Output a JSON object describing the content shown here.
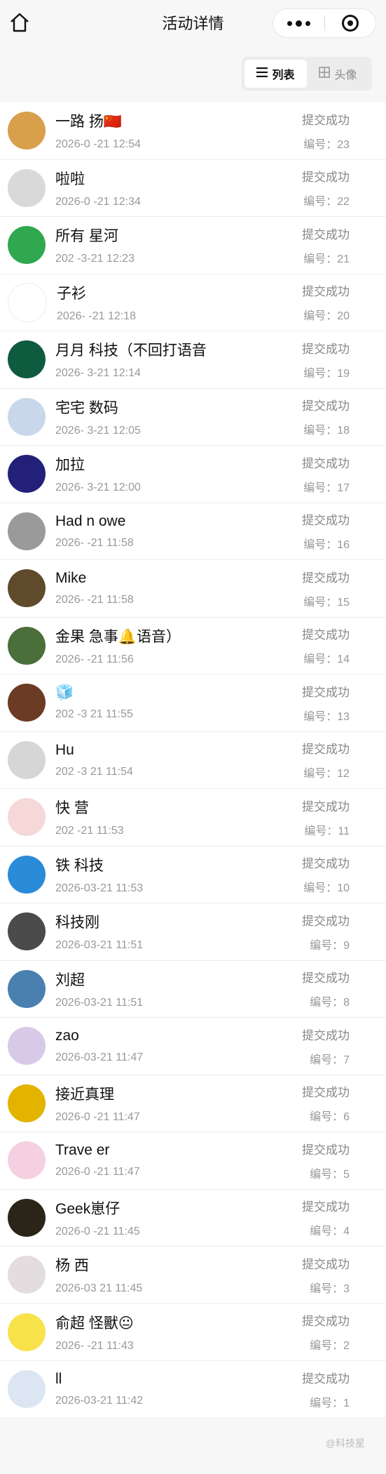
{
  "header": {
    "title": "活动详情"
  },
  "toggle": {
    "list_label": "列表",
    "avatar_label": "头像"
  },
  "status_text": "提交成功",
  "number_prefix": "编号：",
  "rows": [
    {
      "name": "一路 扬🇨🇳",
      "time": "2026-0 -21 12:54",
      "no": "23",
      "color": "#d8a04b"
    },
    {
      "name": "啦啦",
      "time": "2026-0 -21 12:34",
      "no": "22",
      "color": "#d9d9d9"
    },
    {
      "name": "所有 星河",
      "time": "202 -3-21 12:23",
      "no": "21",
      "color": "#2fa84f"
    },
    {
      "name": "子衫",
      "time": "2026- -21 12:18",
      "no": "20",
      "color": "#ffffff"
    },
    {
      "name": "月月 科技（不回打语音",
      "time": "2026- 3-21 12:14",
      "no": "19",
      "color": "#0f5b3f"
    },
    {
      "name": "宅宅 数码",
      "time": "2026- 3-21 12:05",
      "no": "18",
      "color": "#c8d7ea"
    },
    {
      "name": "加拉 ",
      "time": "2026- 3-21 12:00",
      "no": "17",
      "color": "#23207a"
    },
    {
      "name": "Had n owe",
      "time": "2026- -21 11:58",
      "no": "16",
      "color": "#9a9a9a"
    },
    {
      "name": "Mike",
      "time": "2026- -21 11:58",
      "no": "15",
      "color": "#5f4a2c"
    },
    {
      "name": "金果 急事🔔语音）",
      "time": "2026- -21 11:56",
      "no": "14",
      "color": "#4a6f3a"
    },
    {
      "name": "🧊",
      "time": "202 -3 21 11:55",
      "no": "13",
      "color": "#6b3b23"
    },
    {
      "name": "Hu",
      "time": "202 -3 21 11:54",
      "no": "12",
      "color": "#d6d6d6"
    },
    {
      "name": "快 营",
      "time": "202 -21 11:53",
      "no": "11",
      "color": "#f6d8d8"
    },
    {
      "name": "铁 科技",
      "time": "2026-03-21 11:53",
      "no": "10",
      "color": "#2a8bd8"
    },
    {
      "name": "科技刚",
      "time": "2026-03-21 11:51",
      "no": "9",
      "color": "#4b4b4b"
    },
    {
      "name": "刘超",
      "time": "2026-03-21 11:51",
      "no": "8",
      "color": "#4a80b0"
    },
    {
      "name": "zao",
      "time": "2026-03-21 11:47",
      "no": "7",
      "color": "#d9c9e8"
    },
    {
      "name": "接近真理",
      "time": "2026-0 -21 11:47",
      "no": "6",
      "color": "#e2b400"
    },
    {
      "name": "Trave er",
      "time": "2026-0 -21 11:47",
      "no": "5",
      "color": "#f4d0e0"
    },
    {
      "name": "Geek崽仔",
      "time": "2026-0 -21 11:45",
      "no": "4",
      "color": "#2b2418"
    },
    {
      "name": "杨 西",
      "time": "2026-03 21 11:45",
      "no": "3",
      "color": "#e4dde0"
    },
    {
      "name": "俞超 怪獸😐",
      "time": "2026- -21 11:43",
      "no": "2",
      "color": "#f7e24a"
    },
    {
      "name": "ll",
      "time": "2026-03-21 11:42",
      "no": "1",
      "color": "#dbe6f2"
    }
  ],
  "footer": {
    "watermark": "@科技星"
  }
}
